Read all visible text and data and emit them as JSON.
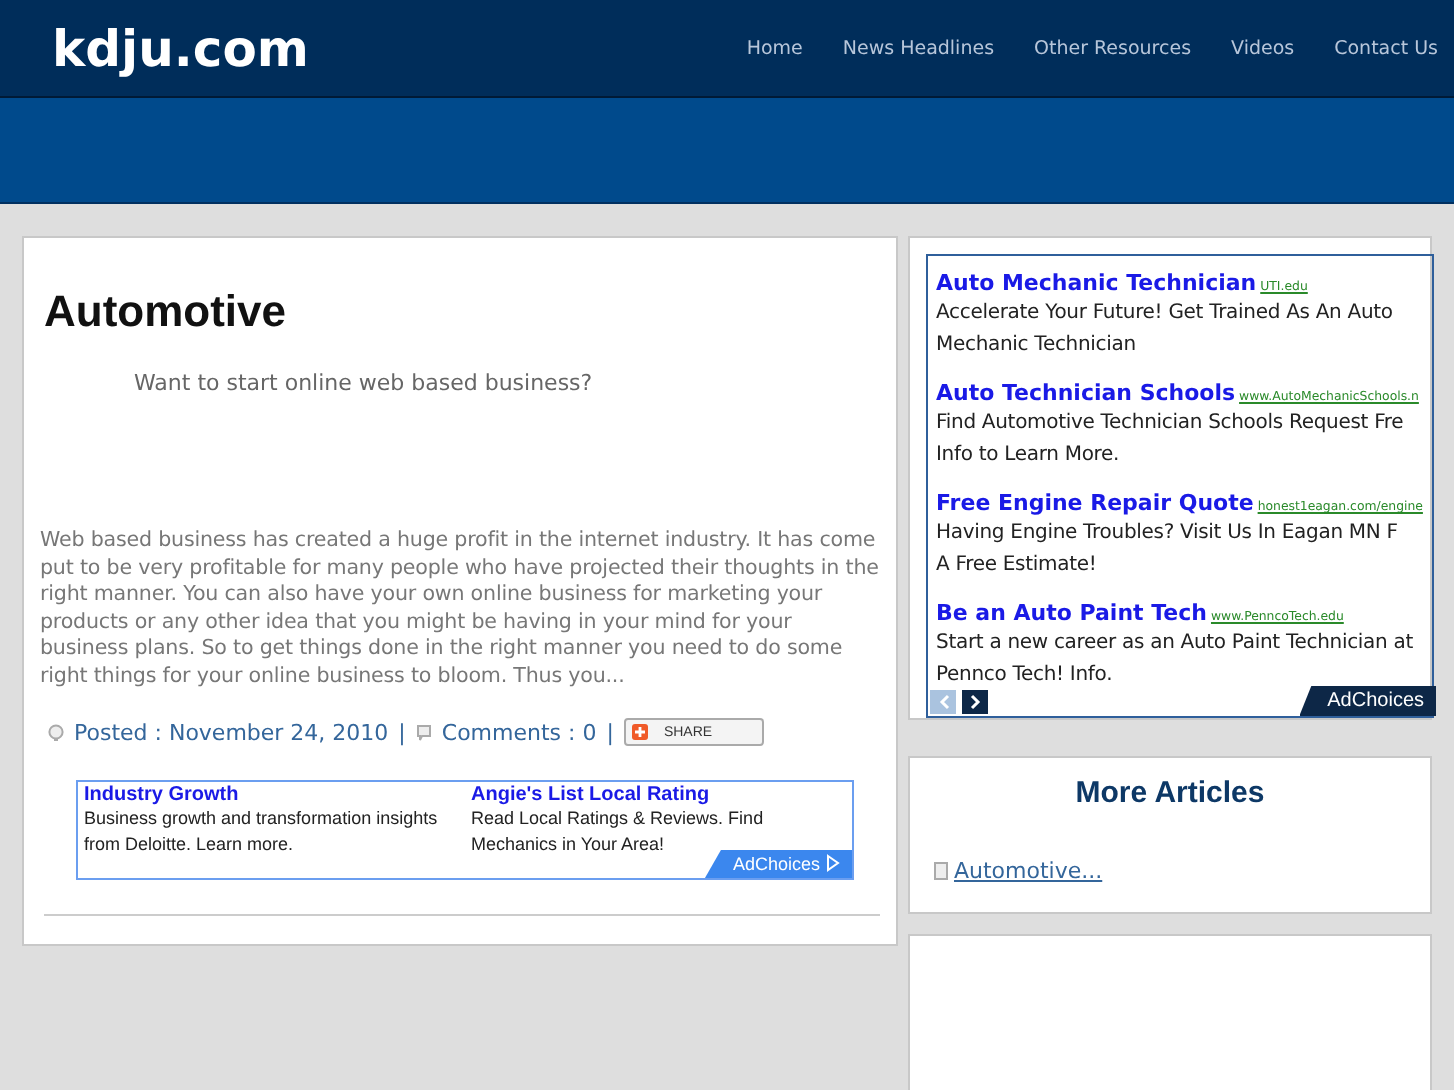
{
  "site": {
    "logo": "kdju.com",
    "nav": [
      "Home",
      "News Headlines",
      "Other Resources",
      "Videos",
      "Contact Us"
    ]
  },
  "article": {
    "title": "Automotive",
    "intro": "Want to start online web based business?",
    "body": "Web based business has created a huge profit in the internet industry. It has come put to be very profitable for many people who have projected their thoughts in the right manner. You can also have your own online business for marketing your products or any other idea that you might be having in your mind for your business plans. So to get things done in the right manner you need to do some right things for your online business to bloom. Thus you...",
    "posted": "Posted : November 24, 2010",
    "comments": "Comments : 0",
    "separator": "|",
    "share": "SHARE"
  },
  "bottom_ads": [
    {
      "title": "Industry Growth",
      "text": "Business growth and transformation insights from Deloitte. Learn more."
    },
    {
      "title": "Angie's List Local Rating",
      "text": "Read Local Ratings & Reviews. Find Mechanics in Your Area!"
    }
  ],
  "bottom_adchoices": "AdChoices",
  "side_ads": [
    {
      "title": "Auto Mechanic Technician",
      "url": "UTI.edu",
      "lines": [
        "Accelerate Your Future! Get Trained As An Auto",
        "Mechanic Technician"
      ]
    },
    {
      "title": "Auto Technician Schools",
      "url": "www.AutoMechanicSchools.n",
      "lines": [
        "Find Automotive Technician Schools Request Fre",
        "Info to Learn More."
      ]
    },
    {
      "title": "Free Engine Repair Quote",
      "url": "honest1eagan.com/engine",
      "lines": [
        "Having Engine Troubles? Visit Us In Eagan MN F",
        "A Free Estimate!"
      ]
    },
    {
      "title": "Be an Auto Paint Tech",
      "url": "www.PenncoTech.edu",
      "lines": [
        "Start a new career as an Auto Paint Technician at",
        "Pennco Tech! Info."
      ]
    }
  ],
  "side_adchoices": "AdChoices",
  "more_articles": {
    "title": "More Articles",
    "items": [
      "Automotive..."
    ]
  }
}
